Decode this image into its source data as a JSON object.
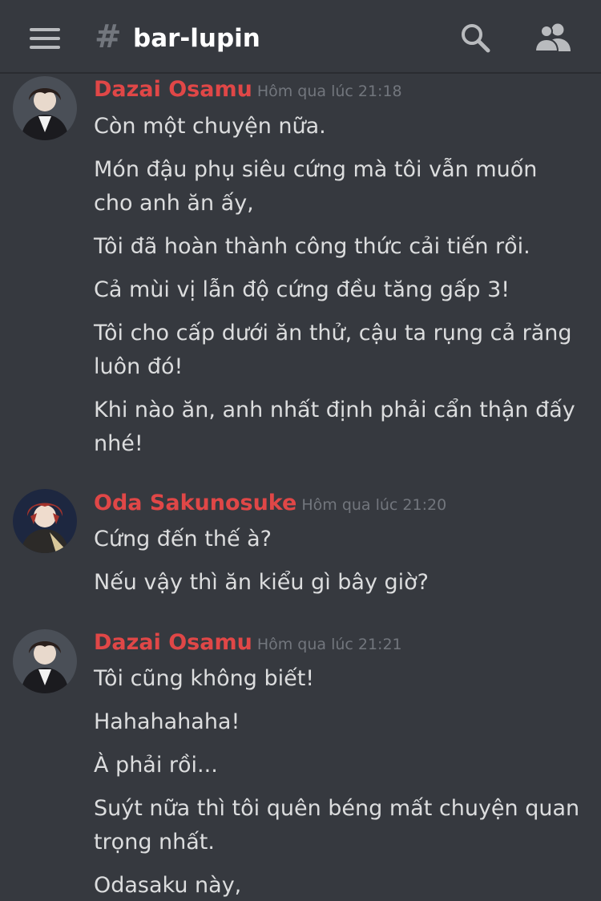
{
  "header": {
    "hash_symbol": "#",
    "channel_name": "bar-lupin",
    "icons": [
      "menu-icon",
      "hash-icon",
      "search-icon",
      "members-icon"
    ]
  },
  "messages": [
    {
      "author": "Dazai Osamu",
      "timestamp": "Hôm qua lúc 21:18",
      "lines": [
        "Còn một chuyện nữa.",
        "Món đậu phụ siêu cứng mà tôi vẫn muốn cho anh ăn ấy,",
        "Tôi đã hoàn thành công thức cải tiến rồi.",
        "Cả mùi vị lẫn độ cứng đều tăng gấp 3!",
        "Tôi cho cấp dưới ăn thử, cậu ta rụng cả răng luôn đó!",
        "Khi nào ăn, anh nhất định phải cẩn thận đấy nhé!"
      ]
    },
    {
      "author": "Oda Sakunosuke",
      "timestamp": "Hôm qua lúc 21:20",
      "lines": [
        "Cứng đến thế à?",
        "Nếu vậy thì ăn kiểu gì bây giờ?"
      ]
    },
    {
      "author": "Dazai Osamu",
      "timestamp": "Hôm qua lúc 21:21",
      "lines": [
        "Tôi cũng không biết!",
        "Hahahahaha!",
        "À phải rồi...",
        "Suýt nữa thì tôi quên béng mất chuyện quan trọng nhất.",
        "Odasaku này,"
      ]
    }
  ],
  "colors": {
    "background": "#36393f",
    "author": "#e04747",
    "message_text": "#dcddde",
    "timestamp": "#72767d",
    "icon": "#b9bbbe"
  }
}
